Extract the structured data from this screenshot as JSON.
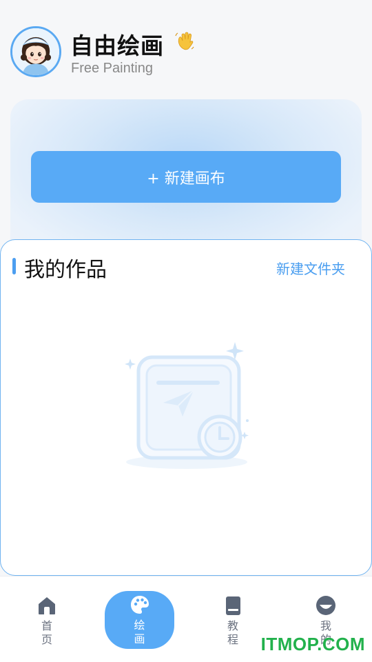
{
  "header": {
    "title": "自由绘画",
    "subtitle": "Free Painting",
    "avatar_icon": "girl-avatar-icon",
    "title_icon": "waving-hand-icon"
  },
  "hero": {
    "new_canvas_label": "+ 新建画布"
  },
  "works": {
    "title": "我的作品",
    "new_folder_label": "新建文件夹",
    "empty_icon": "empty-works-icon"
  },
  "nav": {
    "items": [
      {
        "label": "首页",
        "icon": "home-icon",
        "active": false
      },
      {
        "label": "绘画",
        "icon": "palette-icon",
        "active": true
      },
      {
        "label": "教程",
        "icon": "book-icon",
        "active": false
      },
      {
        "label": "我的",
        "icon": "profile-icon",
        "active": false
      }
    ]
  },
  "watermark": "ITMOP.COM",
  "colors": {
    "accent": "#58aaf6",
    "accent_dark": "#4a9ef0",
    "watermark": "#22b14c"
  }
}
